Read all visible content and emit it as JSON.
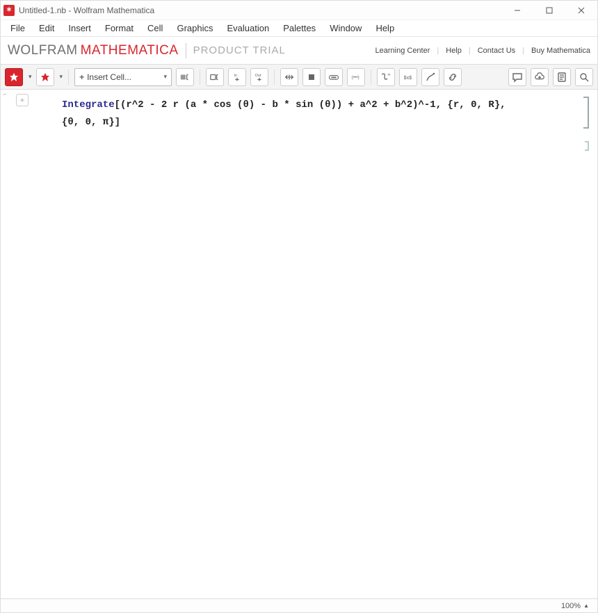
{
  "window": {
    "title": "Untitled-1.nb - Wolfram Mathematica"
  },
  "menu": {
    "items": [
      "File",
      "Edit",
      "Insert",
      "Format",
      "Cell",
      "Graphics",
      "Evaluation",
      "Palettes",
      "Window",
      "Help"
    ]
  },
  "brand": {
    "word1": "WOLFRAM",
    "word2": "MATHEMATICA",
    "trial": "PRODUCT TRIAL",
    "links": [
      "Learning Center",
      "Help",
      "Contact Us",
      "Buy Mathematica"
    ]
  },
  "toolbar": {
    "insert_cell": "Insert Cell..."
  },
  "cell": {
    "line1_fn": "Integrate",
    "line1_body": "[(r^2 - 2 r (a * cos (θ) - b * sin (θ)) + a^2 + b^2)^-1, {r, 0, R},",
    "line2": " {θ, 0, π}]"
  },
  "status": {
    "zoom": "100%"
  }
}
